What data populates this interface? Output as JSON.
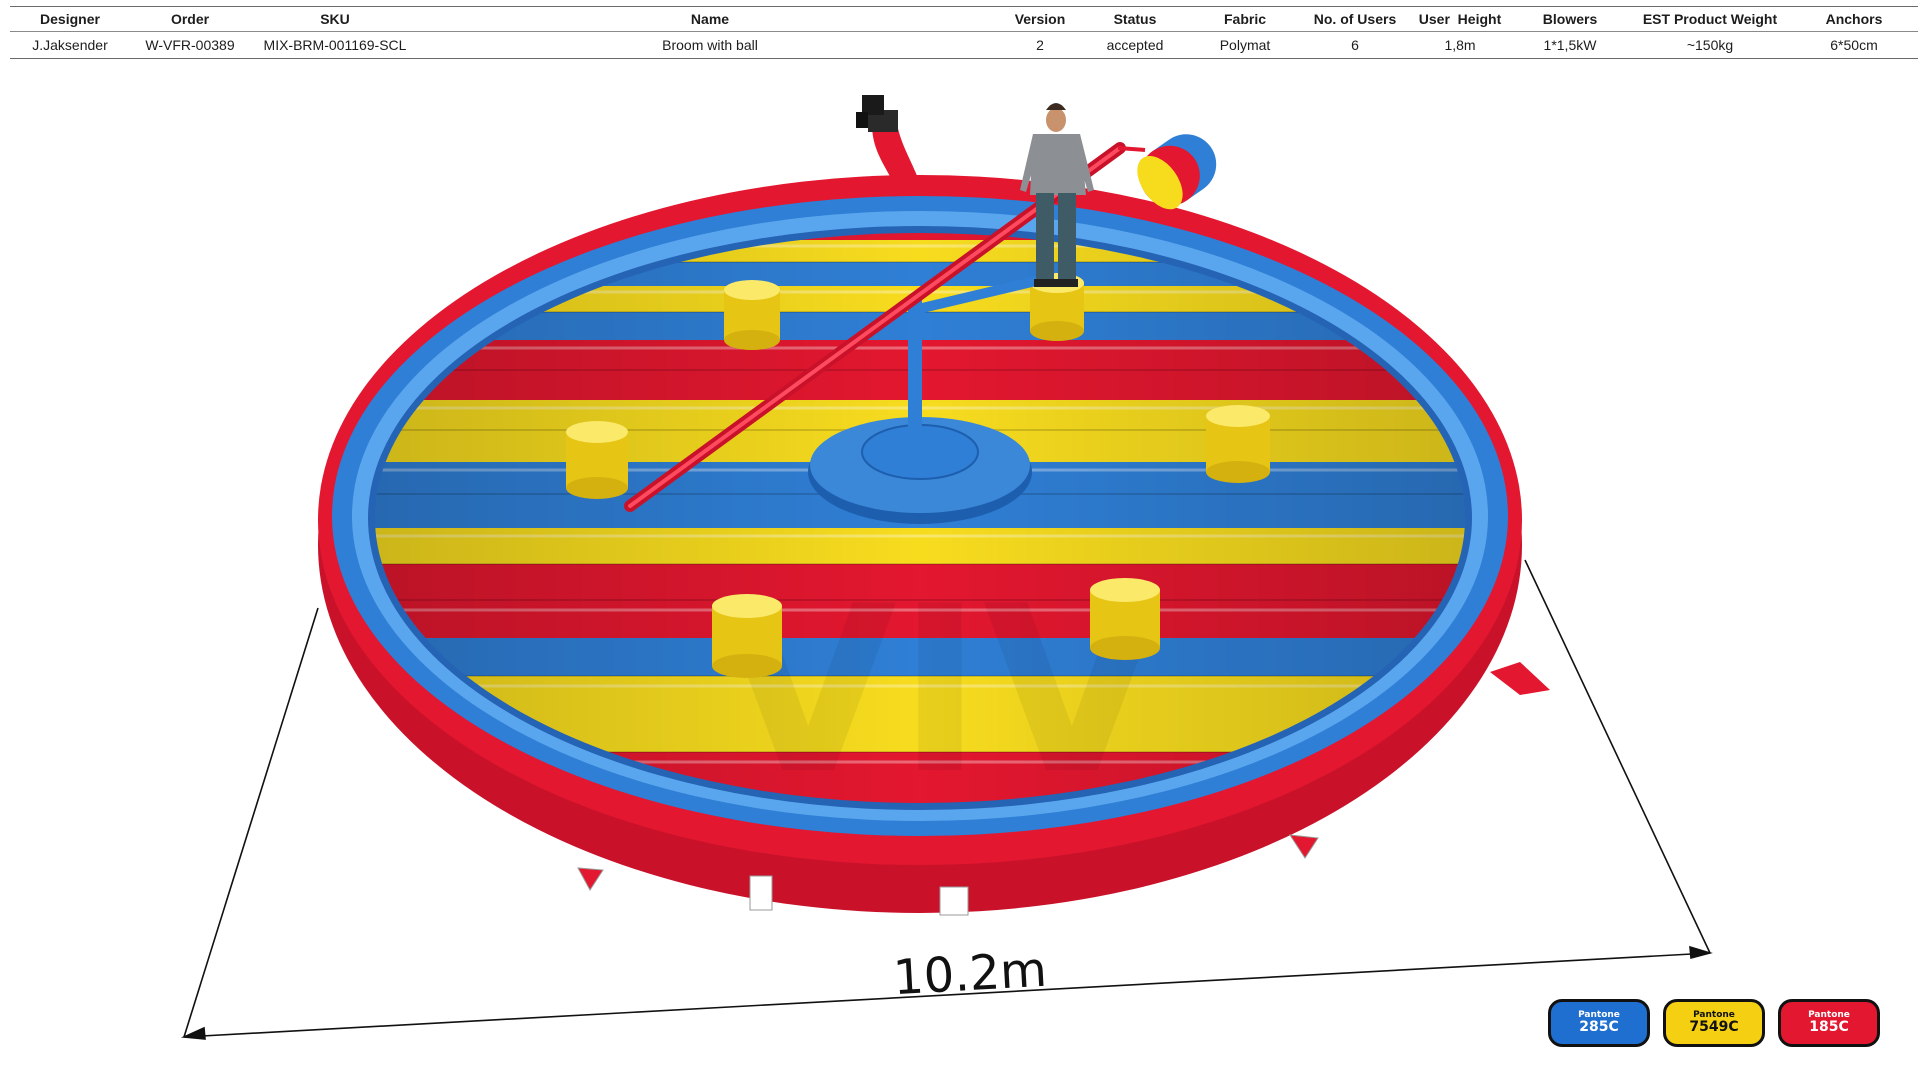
{
  "spec_table": {
    "headers": [
      "Designer",
      "Order",
      "SKU",
      "Name",
      "Version",
      "Status",
      "Fabric",
      "No. of Users",
      "User  Height",
      "Blowers",
      "EST Product Weight",
      "Anchors"
    ],
    "values": [
      "J.Jaksender",
      "W-VFR-00389",
      "MIX-BRM-001169-SCL",
      "Broom with ball",
      "2",
      "accepted",
      "Polymat",
      "6",
      "1,8m",
      "1*1,5kW",
      "~150kg",
      "6*50cm"
    ]
  },
  "drawing": {
    "dimension_label": "10.2m",
    "watermark": "VIV"
  },
  "colors": {
    "blue": "#2f7fd6",
    "yellow": "#f7dc1e",
    "red": "#e3172f"
  },
  "swatches": [
    {
      "prefix": "Pantone",
      "code": "285C",
      "color": "#1f6fd0"
    },
    {
      "prefix": "Pantone",
      "code": "7549C",
      "color": "#f4cf12"
    },
    {
      "prefix": "Pantone",
      "code": "185C",
      "color": "#e3172f"
    }
  ]
}
